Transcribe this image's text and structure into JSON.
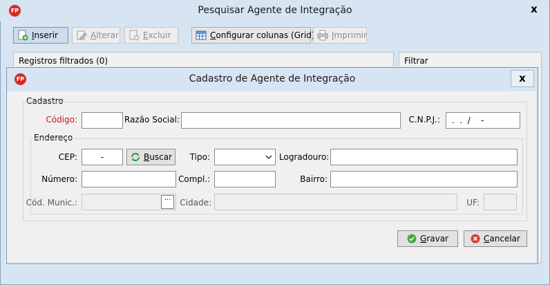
{
  "outer_window": {
    "title": "Pesquisar Agente de Integração",
    "close_glyph": "x",
    "app_icon_text": "FP"
  },
  "toolbar": {
    "insert": {
      "pre": "",
      "key": "I",
      "post": "nserir"
    },
    "edit": {
      "pre": "",
      "key": "A",
      "post": "lterar"
    },
    "delete": {
      "pre": "",
      "key": "E",
      "post": "xcluir"
    },
    "configure": {
      "pre": "",
      "key": "C",
      "post": "onfigurar colunas (Grid)"
    },
    "print": {
      "pre": "",
      "key": "I",
      "post": "mprimir"
    }
  },
  "records_panel": {
    "label": "Registros filtrados (0)"
  },
  "filter_panel": {
    "label": "Filtrar"
  },
  "dialog": {
    "title": "Cadastro de Agente de Integração",
    "close_glyph": "x",
    "app_icon_text": "FP",
    "cadastro_legend": "Cadastro",
    "codigo": {
      "label": "Código:",
      "value": ""
    },
    "razao_social": {
      "label": "Razão Social:",
      "value": ""
    },
    "cnpj": {
      "label": "C.N.P.J.:",
      "value": " .  .  /    -"
    },
    "endereco_legend": "Endereço",
    "cep": {
      "label": "CEP:",
      "value": "-"
    },
    "buscar": {
      "pre": "",
      "key": "B",
      "post": "uscar"
    },
    "tipo": {
      "label": "Tipo:",
      "value": ""
    },
    "logradouro": {
      "label": "Logradouro:",
      "value": ""
    },
    "numero": {
      "label": "Número:",
      "value": ""
    },
    "compl": {
      "label": "Compl.:",
      "value": ""
    },
    "bairro": {
      "label": "Bairro:",
      "value": ""
    },
    "cod_munic": {
      "label": "Cód. Munic.:",
      "value": "",
      "lookup_glyph": "···"
    },
    "cidade": {
      "label": "Cidade:",
      "value": ""
    },
    "uf": {
      "label": "UF:",
      "value": ""
    },
    "gravar": {
      "pre": "",
      "key": "G",
      "post": "ravar"
    },
    "cancelar": {
      "pre": "",
      "key": "C",
      "post": "ancelar"
    }
  },
  "colors": {
    "window_bg": "#d7e4f2",
    "required_label": "#c4161c",
    "brand_red": "#d42b24"
  }
}
